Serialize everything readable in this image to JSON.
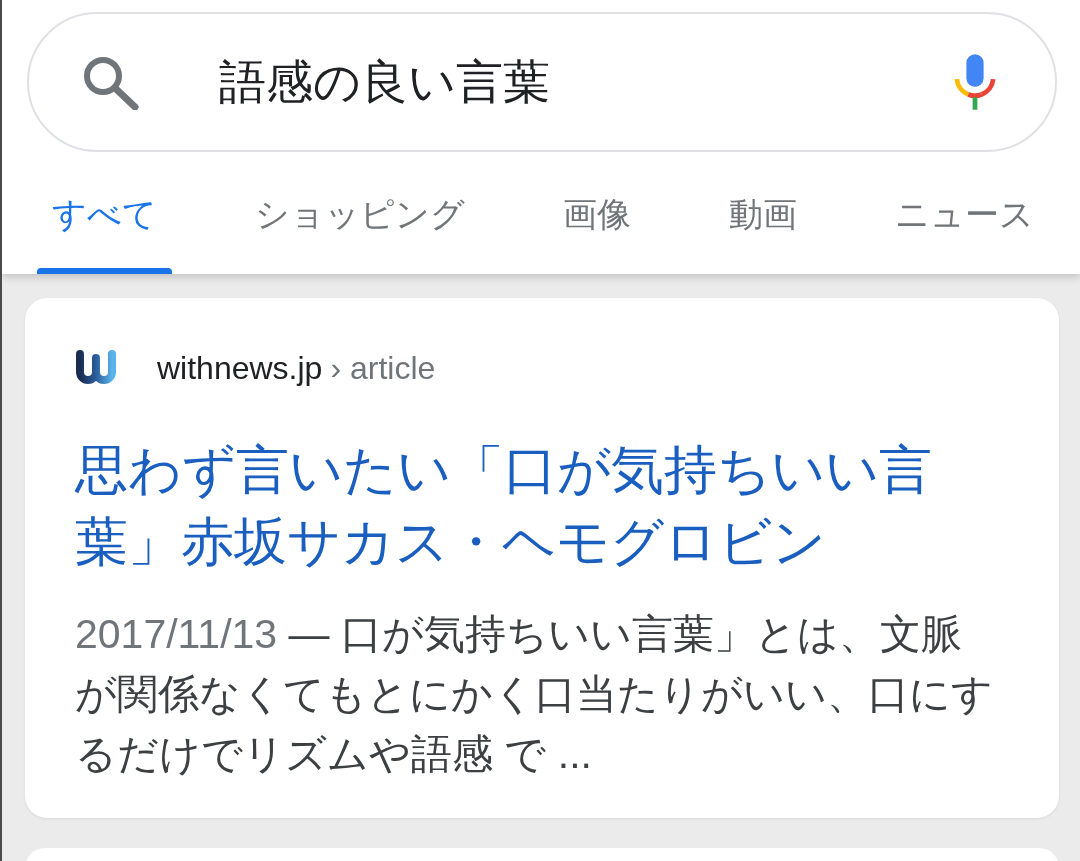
{
  "search": {
    "value": "語感の良い言葉"
  },
  "tabs": [
    {
      "label": "すべて",
      "selected": true
    },
    {
      "label": "ショッピング",
      "selected": false
    },
    {
      "label": "画像",
      "selected": false
    },
    {
      "label": "動画",
      "selected": false
    },
    {
      "label": "ニュース",
      "selected": false
    }
  ],
  "results": [
    {
      "site": "withnews.jp",
      "path": "› article",
      "title": "思わず言いたい「口が気持ちいい言葉」赤坂サカス・ヘモグロビン",
      "date": "2017/11/13",
      "snippet": "— 口が気持ちいい言葉」とは、文脈が関係なくてもとにかく口当たりがいい、口にするだけでリズムや語感 で ..."
    }
  ]
}
